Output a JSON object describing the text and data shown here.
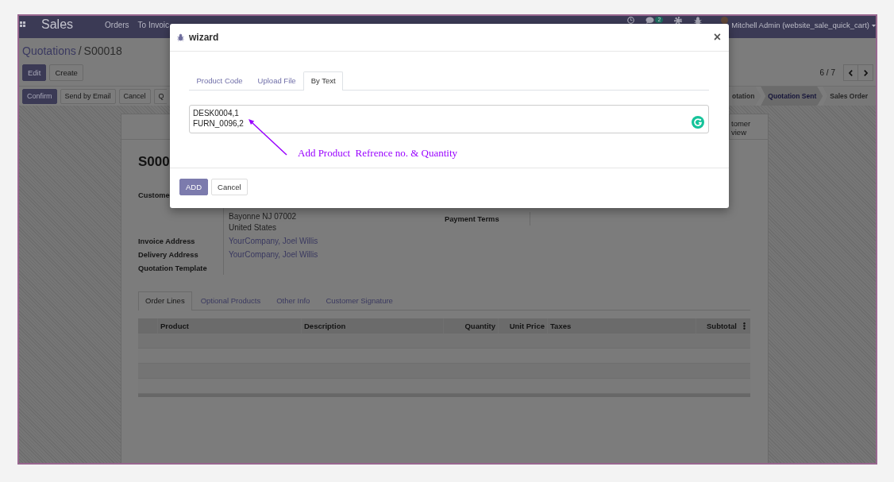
{
  "navbar": {
    "app_title": "Sales",
    "menu": [
      {
        "label": "Orders"
      },
      {
        "label": "To Invoic"
      }
    ],
    "messages_badge": "2",
    "user": "Mitchell Admin (website_sale_quick_cart)"
  },
  "control_panel": {
    "breadcrumb": [
      "Quotations",
      "S00018"
    ],
    "breadcrumb_separator": "/",
    "buttons": [
      {
        "label": "Edit",
        "primary": true
      },
      {
        "label": "Create",
        "primary": false
      }
    ],
    "pager": "6 / 7"
  },
  "form_header": {
    "buttons": [
      {
        "label": "Confirm",
        "primary": true
      },
      {
        "label": "Send by Email",
        "primary": false
      },
      {
        "label": "Cancel",
        "primary": false
      },
      {
        "label": "Q",
        "primary": false
      }
    ],
    "stages": [
      {
        "label": "otation",
        "selected": false
      },
      {
        "label": "Quotation Sent",
        "selected": true
      },
      {
        "label": "Sales Order",
        "selected": false
      }
    ]
  },
  "sheet": {
    "stat_button": "tomer\nview",
    "title": "S000",
    "left_fields": [
      {
        "label": "Custome",
        "value_lines": [
          "Bayonne NJ 07002",
          "United States"
        ],
        "link": false
      },
      {
        "label": "Invoice Address",
        "value": "YourCompany, Joel Willis",
        "link": true
      },
      {
        "label": "Delivery Address",
        "value": "YourCompany, Joel Willis",
        "link": true
      },
      {
        "label": "Quotation Template"
      }
    ],
    "right_fields": [
      {
        "label": "Payment Terms"
      }
    ],
    "tabs": [
      {
        "label": "Order Lines",
        "selected": true
      },
      {
        "label": "Optional Products",
        "selected": false
      },
      {
        "label": "Other Info",
        "selected": false
      },
      {
        "label": "Customer Signature",
        "selected": false
      }
    ],
    "table": {
      "columns": [
        {
          "label": "Product",
          "kind": "text"
        },
        {
          "label": "Description",
          "kind": "text"
        },
        {
          "label": "Quantity",
          "kind": "number"
        },
        {
          "label": "Unit Price",
          "kind": "number"
        },
        {
          "label": "Taxes",
          "kind": "text"
        },
        {
          "label": "Subtotal",
          "kind": "number"
        }
      ]
    }
  },
  "wizard": {
    "title": "wizard",
    "close": "×",
    "tabs": [
      {
        "label": "Product Code",
        "selected": false
      },
      {
        "label": "Upload File",
        "selected": false
      },
      {
        "label": "By Text",
        "selected": true
      }
    ],
    "text_value": "DESK0004,1\nFURN_0096,2",
    "annotation": "Add Product  Refrence no. & Quantity",
    "buttons": [
      {
        "label": "ADD",
        "primary": true
      },
      {
        "label": "Cancel",
        "primary": false
      }
    ]
  }
}
